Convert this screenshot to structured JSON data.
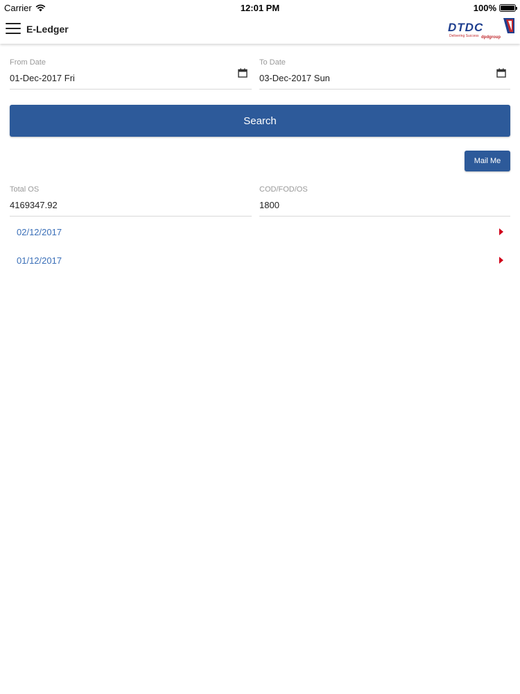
{
  "status_bar": {
    "carrier": "Carrier",
    "time": "12:01 PM",
    "battery": "100%",
    "battery_level": 1.0
  },
  "header": {
    "title": "E-Ledger",
    "logo": {
      "brand": "DTDC",
      "tagline": "Delivering Success",
      "partner": "dpdgroup"
    }
  },
  "filters": {
    "from_date": {
      "label": "From Date",
      "value": "01-Dec-2017 Fri"
    },
    "to_date": {
      "label": "To Date",
      "value": "03-Dec-2017 Sun"
    }
  },
  "actions": {
    "search_label": "Search",
    "mail_label": "Mail Me"
  },
  "summary": {
    "total_os": {
      "label": "Total OS",
      "value": "4169347.92"
    },
    "cod_fod_os": {
      "label": "COD/FOD/OS",
      "value": "1800"
    }
  },
  "ledger_entries": [
    {
      "date": "02/12/2017"
    },
    {
      "date": "01/12/2017"
    }
  ],
  "colors": {
    "primary": "#2d5a9a",
    "link": "#3a6fb8",
    "arrow": "#d0021b",
    "brand_blue": "#1f3f8f",
    "brand_red": "#c0282d"
  },
  "icons": {
    "menu": "hamburger-menu-icon",
    "calendar": "calendar-icon",
    "arrow": "caret-right-icon",
    "wifi": "wifi-icon",
    "battery": "battery-icon"
  }
}
